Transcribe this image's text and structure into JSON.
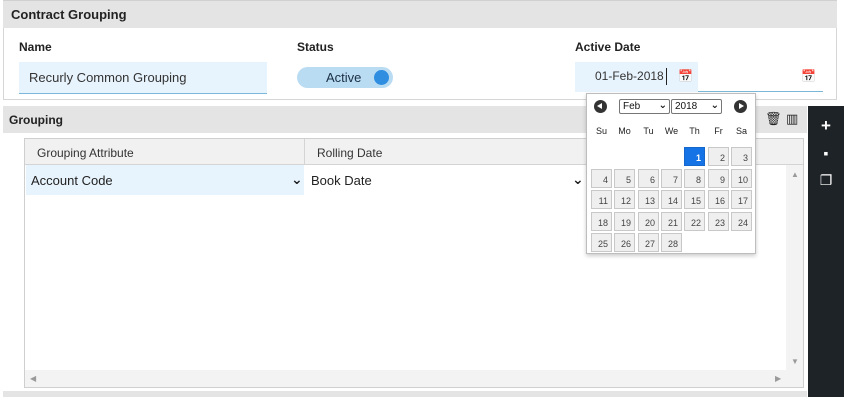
{
  "contract_grouping": {
    "title": "Contract Grouping",
    "name_label": "Name",
    "name_value": "Recurly Common Grouping",
    "status_label": "Status",
    "status_value": "Active",
    "active_date_label": "Active Date",
    "active_date_value": "01-Feb-2018"
  },
  "grouping": {
    "title": "Grouping",
    "columns": [
      "Grouping Attribute",
      "Rolling Date"
    ],
    "row": {
      "attribute": "Account Code",
      "rolling_date": "Book Date"
    }
  },
  "calendar": {
    "month": "Feb",
    "year": "2018",
    "weekdays": [
      "Su",
      "Mo",
      "Tu",
      "We",
      "Th",
      "Fr",
      "Sa"
    ],
    "selected_day": "1",
    "first_weekday_index": 4,
    "days": [
      "1",
      "2",
      "3",
      "4",
      "5",
      "6",
      "7",
      "8",
      "9",
      "10",
      "11",
      "12",
      "13",
      "14",
      "15",
      "16",
      "17",
      "18",
      "19",
      "20",
      "21",
      "22",
      "23",
      "24",
      "25",
      "26",
      "27",
      "28"
    ]
  },
  "icons": {
    "calendar": "calendar-icon",
    "delete": "trash-icon",
    "columns": "columns-icon",
    "add": "plus-icon",
    "save": "save-icon",
    "copy": "copy-icon"
  },
  "colors": {
    "accent": "#1673e6",
    "toggle_bg": "#b9dcf3",
    "toggle_knob": "#2f8ee0",
    "input_bg": "#e8f4fd",
    "toolbar_bg": "#1e2327"
  }
}
